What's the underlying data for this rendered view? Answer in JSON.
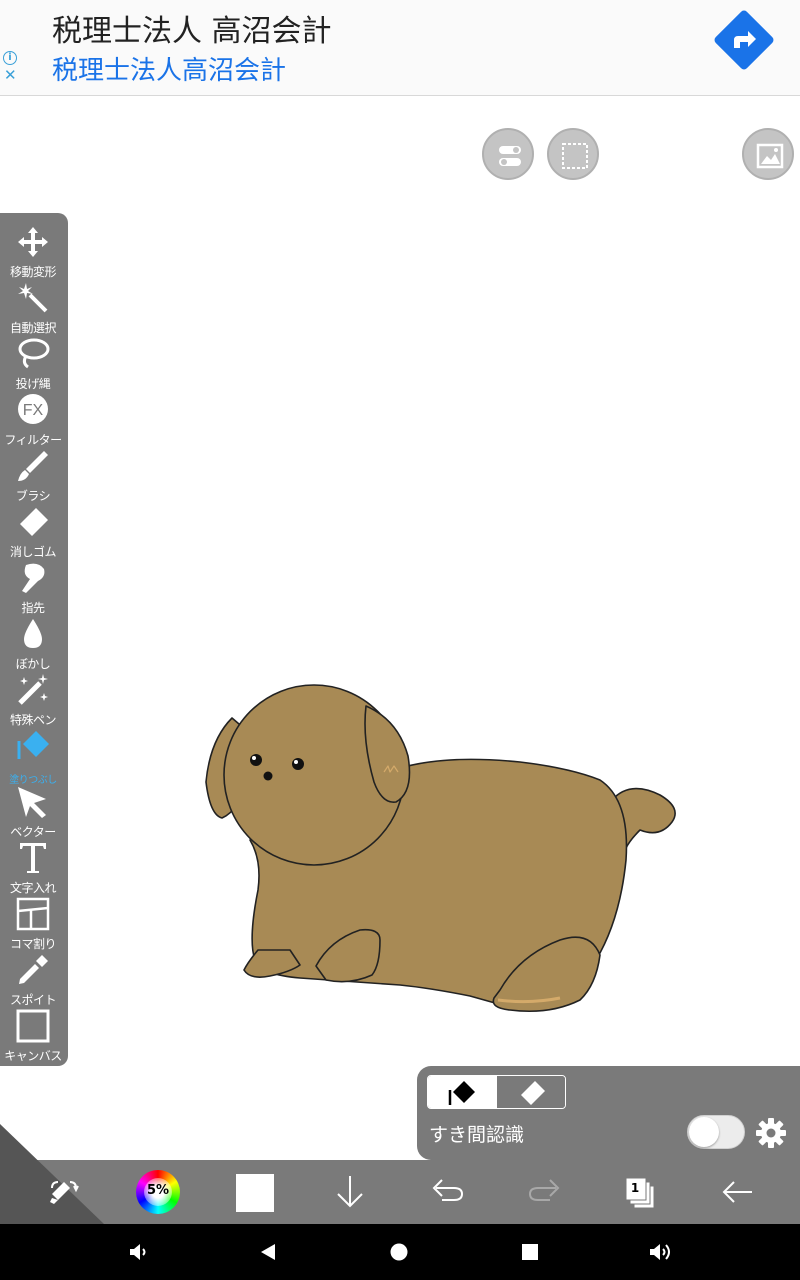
{
  "ad": {
    "title": "税理士法人 高沼会計",
    "subtitle": "税理士法人高沼会計",
    "info_symbol": "i",
    "close_symbol": "✕"
  },
  "tools": [
    {
      "id": "move",
      "label": "移動変形",
      "icon": "move-arrows-icon"
    },
    {
      "id": "auto-select",
      "label": "自動選択",
      "icon": "magic-wand-icon"
    },
    {
      "id": "lasso",
      "label": "投げ縄",
      "icon": "lasso-icon"
    },
    {
      "id": "filter",
      "label": "フィルター",
      "icon": "fx-icon"
    },
    {
      "id": "brush",
      "label": "ブラシ",
      "icon": "brush-icon"
    },
    {
      "id": "eraser",
      "label": "消しゴム",
      "icon": "eraser-icon"
    },
    {
      "id": "finger",
      "label": "指先",
      "icon": "finger-icon"
    },
    {
      "id": "blur",
      "label": "ぼかし",
      "icon": "drop-icon"
    },
    {
      "id": "special-pen",
      "label": "特殊ペン",
      "icon": "special-pen-icon"
    },
    {
      "id": "fill",
      "label": "塗りつぶし",
      "icon": "fill-bucket-icon",
      "active": true
    },
    {
      "id": "vector",
      "label": "ベクター",
      "icon": "vector-cursor-icon"
    },
    {
      "id": "text",
      "label": "文字入れ",
      "icon": "text-t-icon"
    },
    {
      "id": "frame",
      "label": "コマ割り",
      "icon": "frame-split-icon"
    },
    {
      "id": "eyedropper",
      "label": "スポイト",
      "icon": "eyedropper-icon"
    },
    {
      "id": "canvas",
      "label": "キャンバス",
      "icon": "canvas-icon"
    }
  ],
  "fx_text": "FX",
  "fill_panel": {
    "gap_label": "すき間認識",
    "toggle_on": false
  },
  "bottom_bar": {
    "brush_size_pct": "5%",
    "current_color": "#ffffff",
    "layer_count": "1"
  },
  "colors": {
    "toolbar_bg": "#7a7a7a",
    "active_tool": "#3ab0f0",
    "dog_fill": "#a88a55",
    "ad_link": "#1a73e8"
  }
}
